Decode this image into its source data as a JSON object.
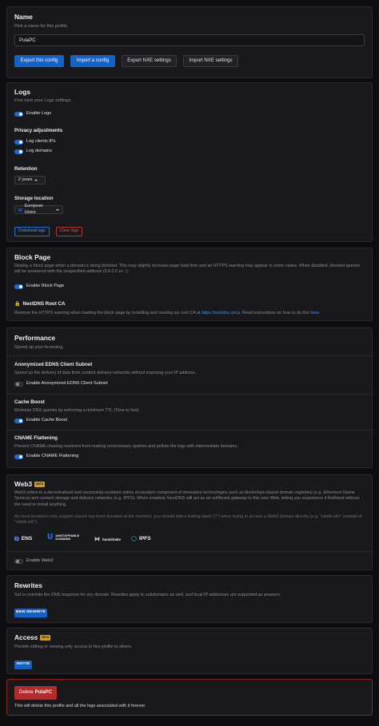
{
  "name_section": {
    "title": "Name",
    "subtitle": "Pick a name for this profile.",
    "input_value": "PulaPC",
    "export_label": "Export this config",
    "import_label": "Import a config",
    "export_nxe_label": "Export NXE settings",
    "import_nxe_label": "Import NXE settings"
  },
  "logs": {
    "title": "Logs",
    "subtitle": "Fine tune your Logs settings.",
    "enable_label": "Enable Logs",
    "privacy_title": "Privacy adjustments",
    "log_ips_label": "Log clients IPs",
    "log_domains_label": "Log domains",
    "retention_title": "Retention",
    "retention_value": "2 years",
    "storage_title": "Storage location",
    "storage_value": "European Union",
    "download_label": "Download logs",
    "clear_label": "Clear logs"
  },
  "block_page": {
    "title": "Block Page",
    "description": "Display a block page when a domain is being blocked. This may slightly increase page load time and an HTTPS warning may appear in some cases. When disabled, blocked queries will be answered with the unspecified address (0.0.0.0 or ::).",
    "enable_label": "Enable Block Page",
    "root_ca_title": "NextDNS Root CA",
    "root_ca_desc_before": "Remove the HTTPS warning when loading the block page by installing and trusting our root CA at",
    "root_ca_link": "https://nextdns.io/ca",
    "root_ca_desc_middle": ". Read instructions on how to do this",
    "root_ca_here": "here",
    "root_ca_end": "."
  },
  "performance": {
    "title": "Performance",
    "subtitle": "Speed up your browsing.",
    "ecs_title": "Anonymized EDNS Client Subnet",
    "ecs_desc": "Speed up the delivery of data from content delivery networks without exposing your IP address.",
    "ecs_label": "Enable Anonymized EDNS Client Subnet",
    "cache_title": "Cache Boost",
    "cache_desc": "Minimize DNS queries by enforcing a minimum TTL (Time to live).",
    "cache_label": "Enable Cache Boost",
    "cname_title": "CNAME Flattening",
    "cname_desc": "Prevent CNAME-chasing resolvers from making unnecessary queries and pollute the logs with intermediate domains.",
    "cname_label": "Enable CNAME Flattening"
  },
  "web3": {
    "title": "Web3",
    "badge": "BETA",
    "description": "Web3 refers to a decentralized and censorship-resistant online ecosystem comprised of innovative technologies such as blockchain-based domain registries (e.g. Ethereum Name Service) and content storage and delivery networks (e.g. IPFS). When enabled, NextDNS will act as an unfiltered gateway to this new Web, letting you experience it firsthand without the need to install anything.",
    "note": "As most browsers only support classic top-level domains at the moment, you should add a trailing slash (\"/\") when trying to access a Web3 domain directly (e.g. \"vitalik.eth/\" instead of \"vitalik.eth\").",
    "logos": [
      "ENS",
      "UNSTOPPABLE DOMAINS",
      "handshake",
      "IPFS"
    ],
    "enable_label": "Enable Web3"
  },
  "rewrites": {
    "title": "Rewrites",
    "description": "Set or override the DNS response for any domain. Rewrites apply to subdomains as well, and local IP addresses are supported as answers.",
    "button_label": "NEW REWRITE"
  },
  "access": {
    "title": "Access",
    "badge": "BETA",
    "description": "Provide editing or viewing-only access to this profile to others.",
    "button_label": "INVITE"
  },
  "delete": {
    "button_prefix": "Delete",
    "button_name": "PulaPC",
    "warning": "This will delete this profile and all the logs associated with it forever."
  },
  "colors": {
    "background": "#0d0d0f",
    "card": "#19191b",
    "primary": "#1462c8",
    "danger": "#b52a2a",
    "beta": "#d49a1a"
  }
}
